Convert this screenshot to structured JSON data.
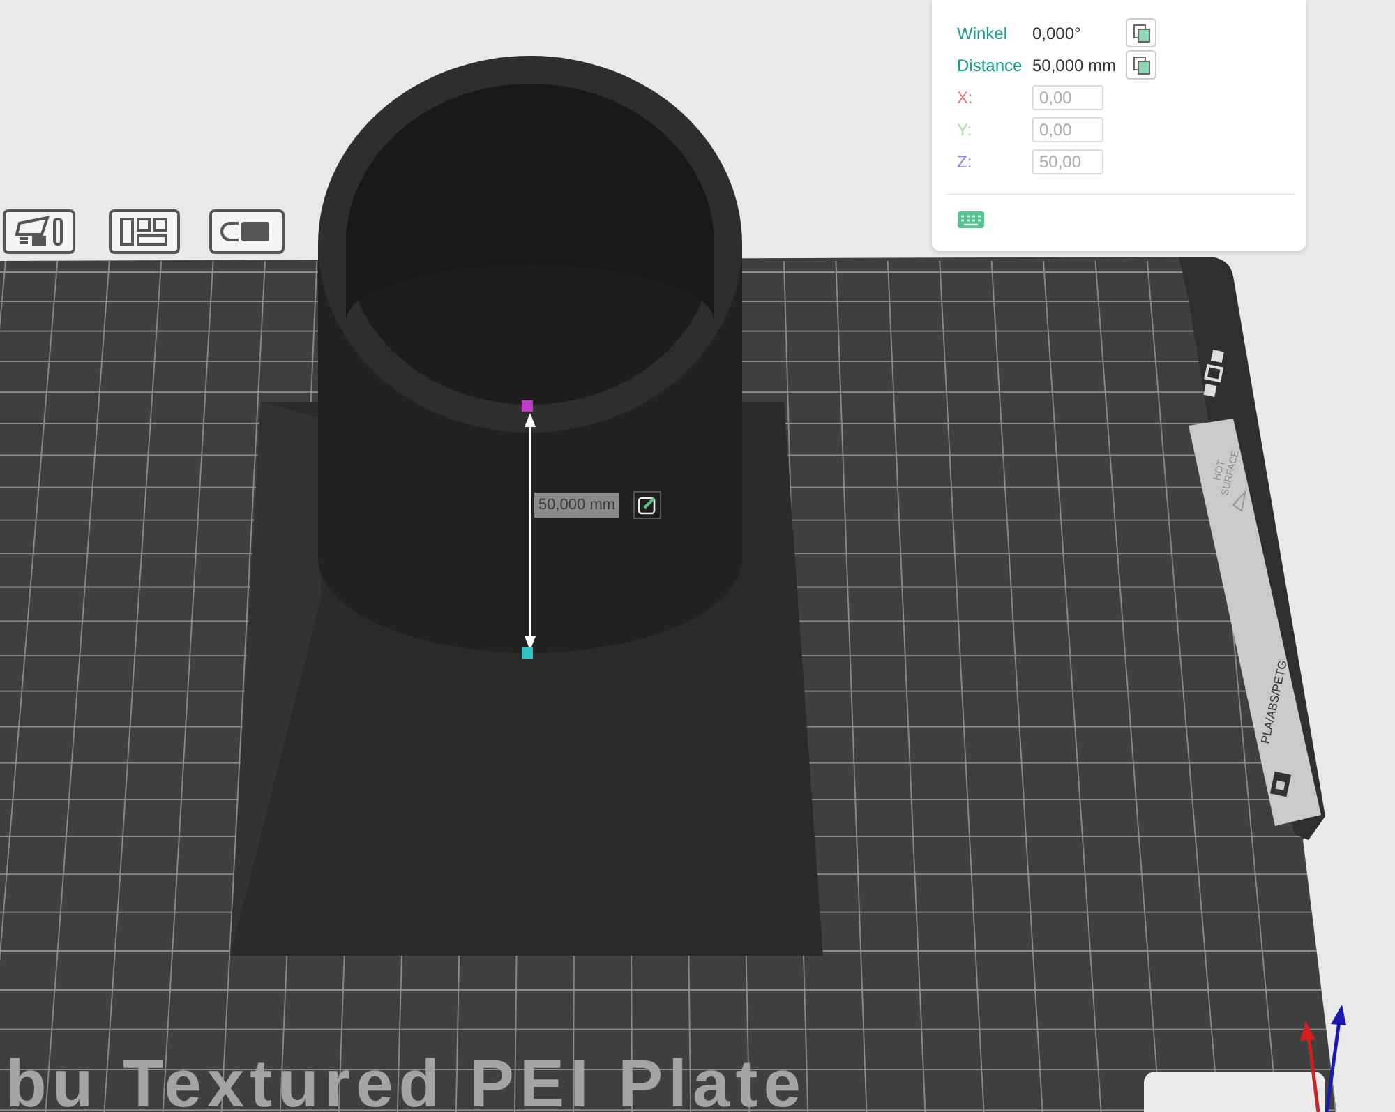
{
  "measure_panel": {
    "rows": [
      {
        "kind": "readout",
        "label": "Winkel",
        "value": "0,000°"
      },
      {
        "kind": "readout",
        "label": "Distance",
        "value": "50,000 mm"
      },
      {
        "kind": "coordinate",
        "label": "X:",
        "value": "0,00",
        "color": "#f07a7a"
      },
      {
        "kind": "coordinate",
        "label": "Y:",
        "value": "0,00",
        "color": "#a6e3a6"
      },
      {
        "kind": "coordinate",
        "label": "Z:",
        "value": "50,00",
        "color": "#8d80e6"
      }
    ]
  },
  "dimension_label": "50,000 mm",
  "plate": {
    "name": "bu Textured PEI Plate",
    "warning_lines": [
      "HOT",
      "SURFACE"
    ],
    "material": "PLA/ABS/PETG"
  }
}
